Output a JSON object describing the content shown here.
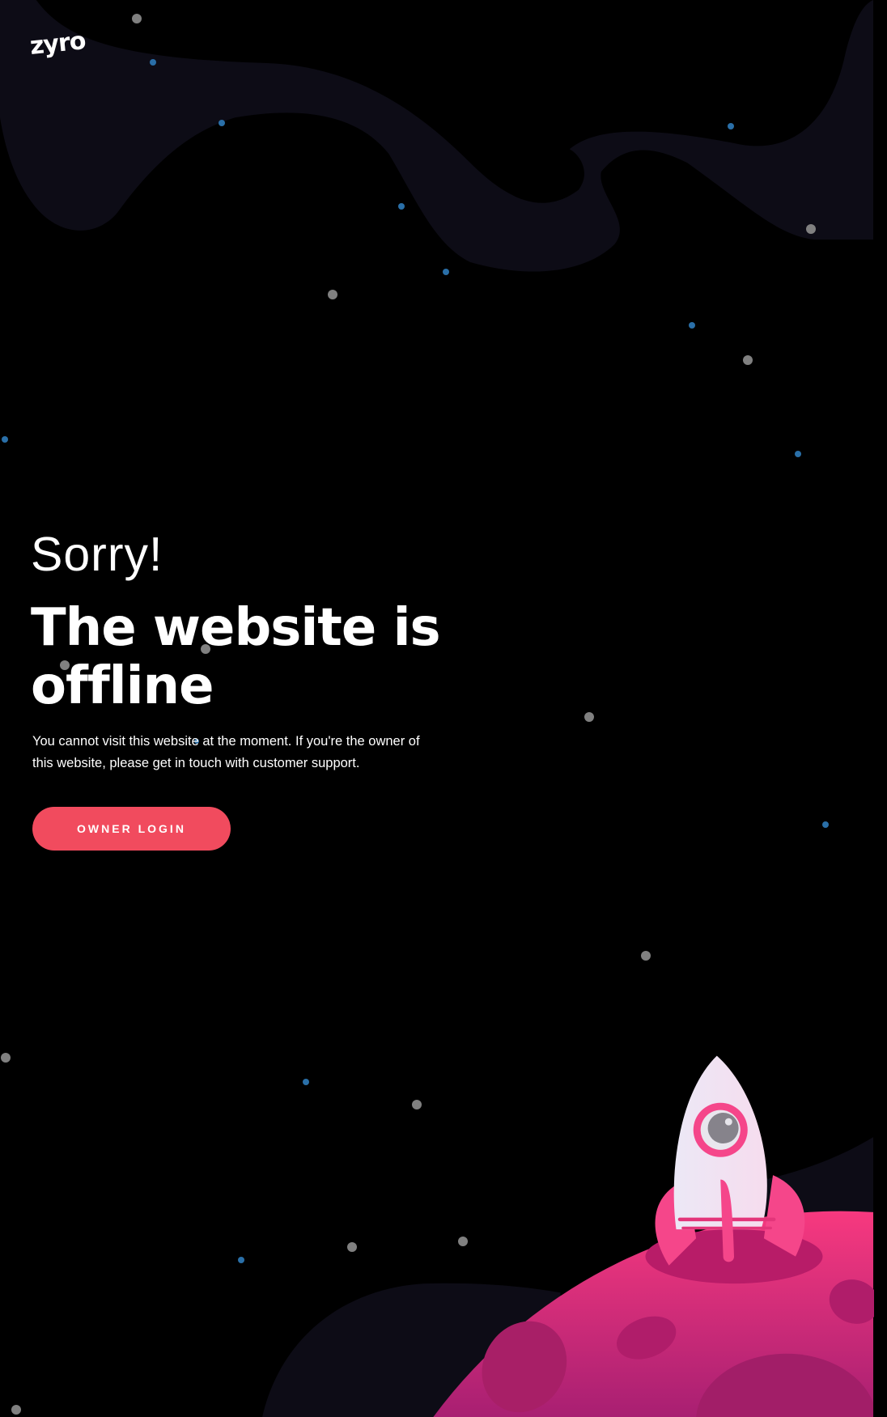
{
  "brand": {
    "logo_text": "zyro"
  },
  "main": {
    "greeting": "Sorry!",
    "headline": "The website is offline",
    "description": "You cannot visit this website at the moment. If you're the owner of this website, please get in touch with customer support.",
    "owner_login_label": "OWNER LOGIN"
  },
  "colors": {
    "background": "#000000",
    "wave": "#0d0c16",
    "button": "#f14b5e",
    "planet": "#e0357f",
    "rocket": "#f0eaf5"
  },
  "illustration": {
    "icons": [
      "rocket-icon",
      "planet-icon",
      "astronaut-icon",
      "star-icon"
    ]
  }
}
